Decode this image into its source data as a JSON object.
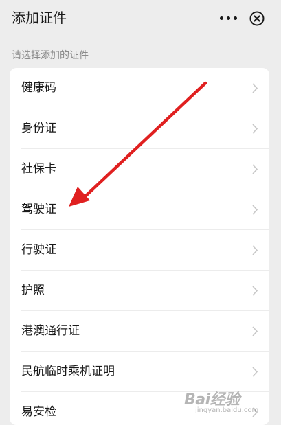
{
  "header": {
    "title": "添加证件"
  },
  "section_label": "请选择添加的证件",
  "items": [
    {
      "label": "健康码"
    },
    {
      "label": "身份证"
    },
    {
      "label": "社保卡"
    },
    {
      "label": "驾驶证"
    },
    {
      "label": "行驶证"
    },
    {
      "label": "护照"
    },
    {
      "label": "港澳通行证"
    },
    {
      "label": "民航临时乘机证明"
    },
    {
      "label": "易安检"
    }
  ],
  "annotation": {
    "arrow_color": "#e02020"
  },
  "watermark": {
    "brand": "Bai经验",
    "url": "jingyan.baidu.com"
  },
  "colors": {
    "background": "#ededed",
    "card": "#ffffff",
    "text": "#1a1a1a",
    "muted": "#8a8a8a",
    "chevron": "#c7c7c7"
  }
}
